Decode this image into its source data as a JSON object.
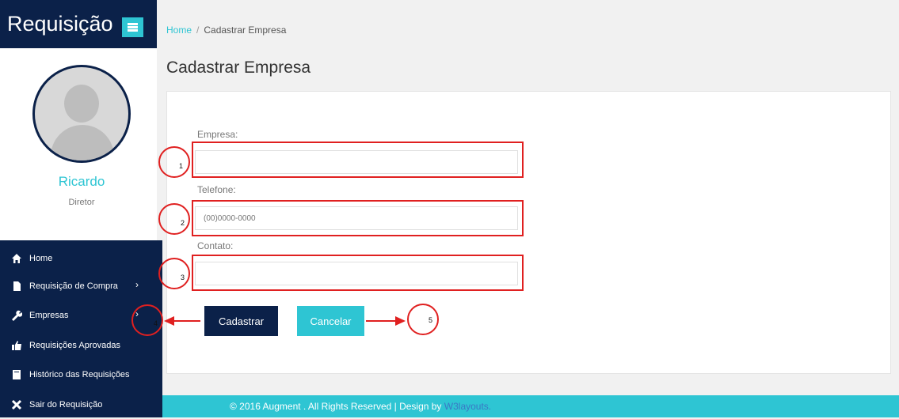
{
  "sidebar": {
    "app_title": "Requisição",
    "user": {
      "name": "Ricardo",
      "role": "Diretor"
    },
    "nav": [
      {
        "label": "Home",
        "icon": "home-icon"
      },
      {
        "label": "Requisição de Compra",
        "icon": "file-icon"
      },
      {
        "label": "Empresas",
        "icon": "wrench-icon"
      },
      {
        "label": "Requisições Aprovadas",
        "icon": "thumbs-up-icon"
      },
      {
        "label": "Histórico das Requisições",
        "icon": "book-icon"
      },
      {
        "label": "Sair do Requisição",
        "icon": "close-icon"
      }
    ]
  },
  "breadcrumb": {
    "home": "Home",
    "separator": "/",
    "current": "Cadastrar Empresa"
  },
  "page_title": "Cadastrar Empresa",
  "form": {
    "empresa": {
      "label": "Empresa:",
      "value": "",
      "placeholder": ""
    },
    "telefone": {
      "label": "Telefone:",
      "value": "",
      "placeholder": "(00)0000-0000"
    },
    "contato": {
      "label": "Contato:",
      "value": "",
      "placeholder": ""
    },
    "submit_label": "Cadastrar",
    "cancel_label": "Cancelar"
  },
  "annotations": [
    "1",
    "2",
    "3",
    "4",
    "5"
  ],
  "footer": {
    "text": "© 2016 Augment . All Rights Reserved | Design by ",
    "link": "W3layouts."
  },
  "colors": {
    "navy": "#0b2149",
    "accent": "#2ec5d3",
    "annotation": "#e02020"
  }
}
